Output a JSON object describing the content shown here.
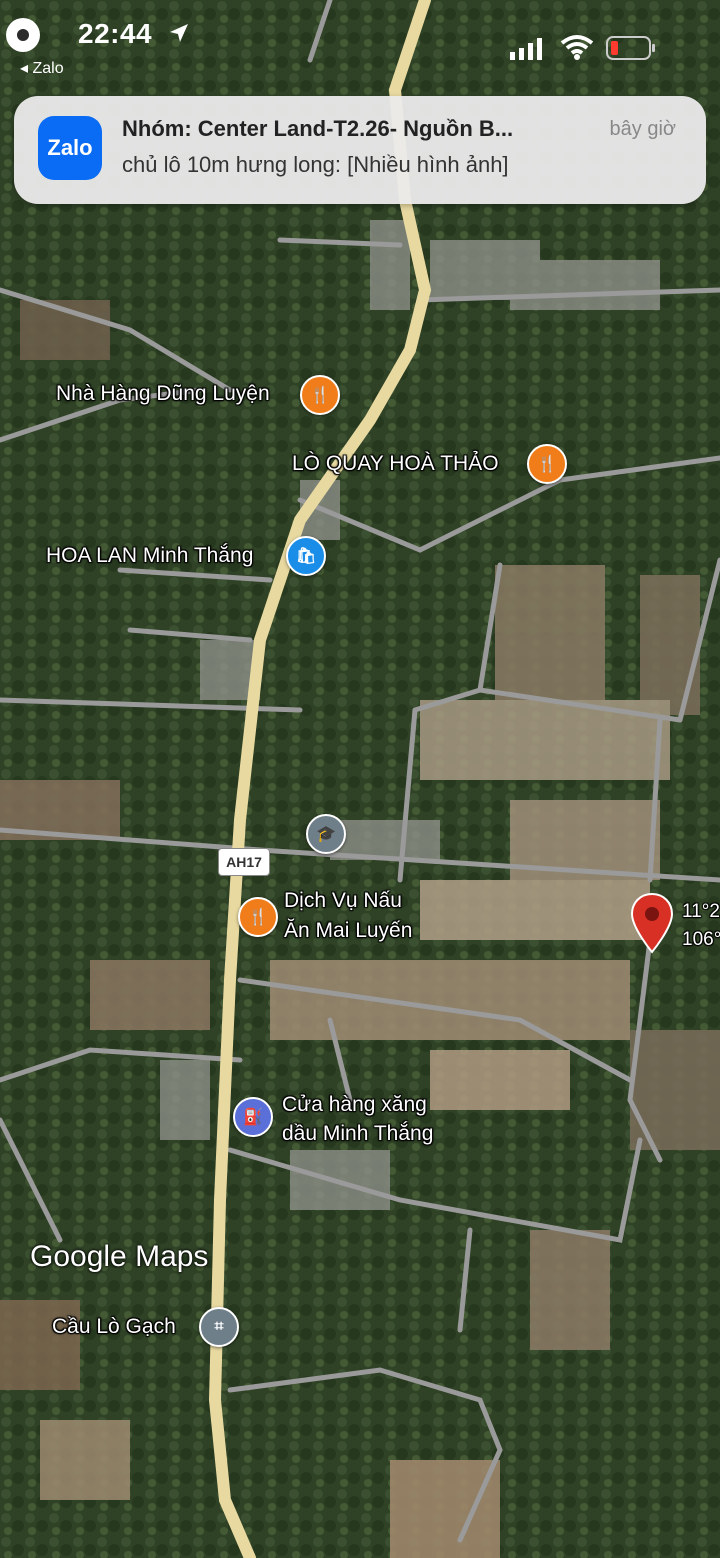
{
  "status_bar": {
    "time": "22:44",
    "back_app": "◂ Zalo"
  },
  "notification": {
    "app_icon_text": "Zalo",
    "title": "Nhóm: Center Land-T2.26- Nguồn B...",
    "body": "chủ lô 10m hưng long: [Nhiều hình ảnh]",
    "time": "bây giờ"
  },
  "map": {
    "places": [
      {
        "name": "Nhà Hàng Dũng Luyện",
        "icon": "restaurant-icon"
      },
      {
        "name": "LÒ QUAY HOÀ THẢO",
        "icon": "restaurant-icon"
      },
      {
        "name": "HOA LAN Minh Thắng",
        "icon": "shopping-bag-icon"
      },
      {
        "name": "Dịch Vụ Nấu",
        "icon": "restaurant-icon"
      },
      {
        "name": "Ăn Mai Luyến",
        "icon": ""
      },
      {
        "name": "Cửa hàng xăng",
        "icon": "gas-station-icon"
      },
      {
        "name": "dầu Minh Thắng",
        "icon": ""
      },
      {
        "name": "Cầu Lò Gạch",
        "icon": "bridge-icon"
      }
    ],
    "road_shield": "AH17",
    "pin_coords": [
      "11°2",
      "106°"
    ],
    "watermark": "Google Maps",
    "colors": {
      "highway": "#e8d9a0",
      "roads": "#9a9a9a",
      "pin": "#d93025",
      "food_poi": "#f07c1a"
    }
  }
}
